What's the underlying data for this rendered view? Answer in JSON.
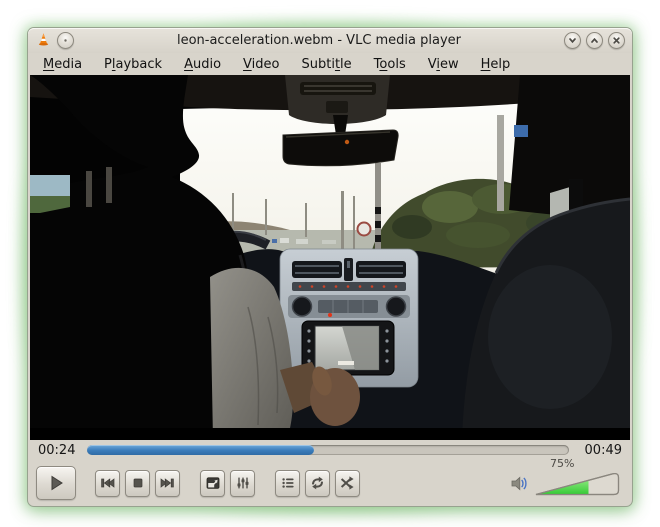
{
  "window": {
    "title": "leon-acceleration.webm - VLC media player",
    "app_icon": "vlc-cone",
    "titlebar_button_icons": [
      "window-menu-dot",
      "chevron-down",
      "chevron-up",
      "close-x"
    ]
  },
  "menubar": {
    "items": [
      {
        "label": "Media",
        "pre": "",
        "key": "M",
        "post": "edia"
      },
      {
        "label": "Playback",
        "pre": "P",
        "key": "l",
        "post": "ayback"
      },
      {
        "label": "Audio",
        "pre": "",
        "key": "A",
        "post": "udio"
      },
      {
        "label": "Video",
        "pre": "",
        "key": "V",
        "post": "ideo"
      },
      {
        "label": "Subtitle",
        "pre": "Subti",
        "key": "t",
        "post": "le"
      },
      {
        "label": "Tools",
        "pre": "T",
        "key": "o",
        "post": "ols"
      },
      {
        "label": "View",
        "pre": "V",
        "key": "i",
        "post": "ew"
      },
      {
        "label": "Help",
        "pre": "",
        "key": "H",
        "post": "elp"
      }
    ]
  },
  "video": {
    "alt": "View from rear seat of a car: driver silhouette on left, empty passenger headrest on right, bright windshield with rearview mirror, dashboard with media screen, trees and poles outside"
  },
  "seek": {
    "elapsed": "00:24",
    "total": "00:49",
    "progress_percent": 47,
    "bar_color": "#3a7cba"
  },
  "controls": {
    "button_icons": [
      "play",
      "skip-previous",
      "stop",
      "skip-next",
      "fullscreen",
      "extended-settings-equalizer",
      "playlist",
      "loop",
      "shuffle"
    ]
  },
  "volume": {
    "label": "75%",
    "fill_percent": 62,
    "icon": "speaker-with-waves",
    "fill_color": "#3ecb3e"
  }
}
